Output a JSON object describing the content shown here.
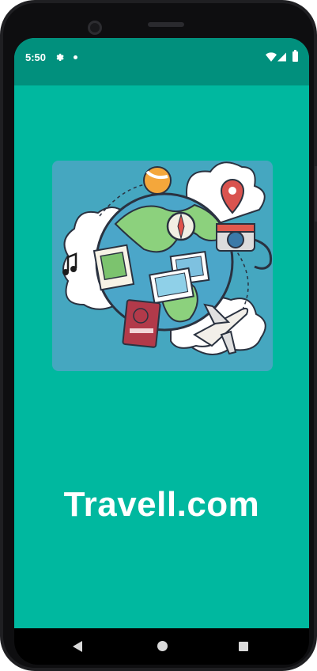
{
  "status_bar": {
    "time": "5:50",
    "icons": [
      "gear-icon",
      "notification-dot-icon",
      "wifi-icon",
      "signal-icon",
      "battery-icon"
    ]
  },
  "main": {
    "illustration": "travel-globe-illustration",
    "title": "Travell.com"
  },
  "navigation_bar": {
    "buttons": [
      "back-icon",
      "home-icon",
      "recents-icon"
    ]
  },
  "colors": {
    "screen_background": "#00b89f",
    "status_bar": "#01907d",
    "illustration_background": "#45a7c0",
    "title_text": "#ffffff"
  }
}
